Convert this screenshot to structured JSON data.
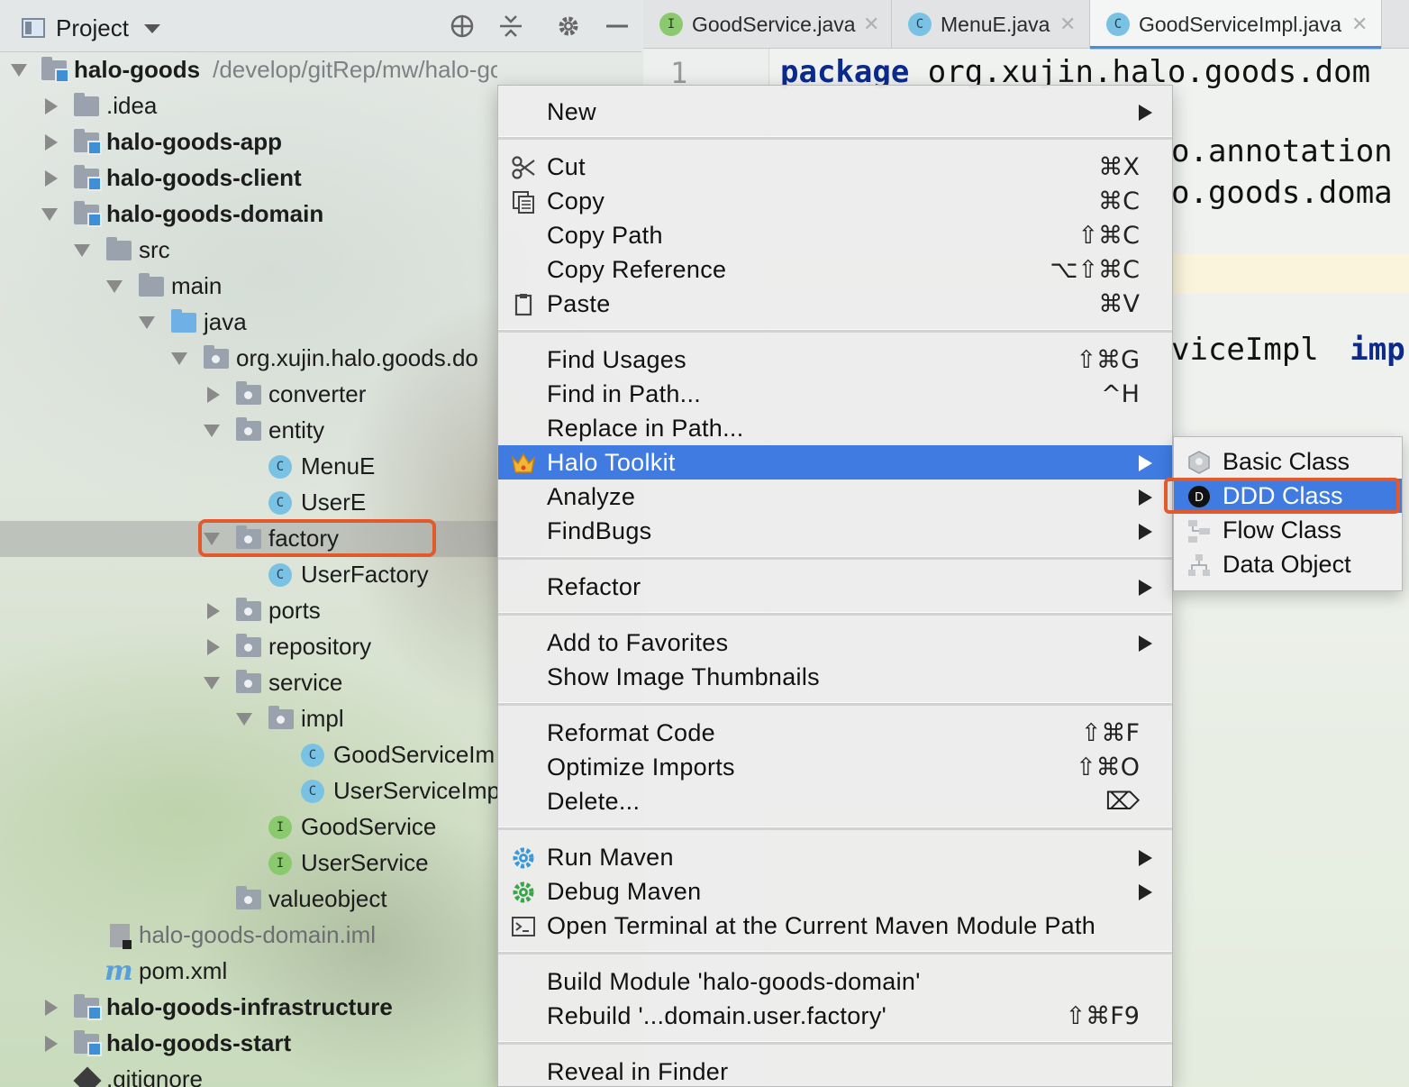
{
  "project_panel": {
    "title": "Project",
    "tree": [
      {
        "label": "halo-goods",
        "path": "/develop/gitRep/mw/halo-goods"
      },
      {
        "label": ".idea"
      },
      {
        "label": "halo-goods-app"
      },
      {
        "label": "halo-goods-client"
      },
      {
        "label": "halo-goods-domain"
      },
      {
        "label": "src"
      },
      {
        "label": "main"
      },
      {
        "label": "java"
      },
      {
        "label": "org.xujin.halo.goods.do"
      },
      {
        "label": "converter"
      },
      {
        "label": "entity"
      },
      {
        "label": "MenuE",
        "badge": "C"
      },
      {
        "label": "UserE",
        "badge": "C"
      },
      {
        "label": "factory"
      },
      {
        "label": "UserFactory",
        "badge": "C"
      },
      {
        "label": "ports"
      },
      {
        "label": "repository"
      },
      {
        "label": "service"
      },
      {
        "label": "impl"
      },
      {
        "label": "GoodServiceIm",
        "badge": "C"
      },
      {
        "label": "UserServiceImp",
        "badge": "C"
      },
      {
        "label": "GoodService",
        "badge": "I"
      },
      {
        "label": "UserService",
        "badge": "I"
      },
      {
        "label": "valueobject"
      },
      {
        "label": "halo-goods-domain.iml"
      },
      {
        "label": "pom.xml",
        "icon": "m"
      },
      {
        "label": "halo-goods-infrastructure"
      },
      {
        "label": "halo-goods-start"
      },
      {
        "label": ".gitignore"
      }
    ]
  },
  "editor": {
    "tabs": [
      {
        "label": "GoodService.java",
        "badge": "I"
      },
      {
        "label": "MenuE.java",
        "badge": "C"
      },
      {
        "label": "GoodServiceImpl.java",
        "badge": "C"
      }
    ],
    "line_number": "1",
    "code": {
      "line1_kw": "package",
      "line1_rest": "org.xujin.halo.goods.dom",
      "line2": "o.annotation",
      "line3": "o.goods.doma",
      "line4_text": "viceImpl",
      "line4_kw": "imp"
    }
  },
  "context_menu": {
    "items": [
      {
        "label": "New",
        "submenu": true
      },
      {
        "label": "Cut",
        "shortcut": "⌘X",
        "icon": "scissors-icon"
      },
      {
        "label": "Copy",
        "shortcut": "⌘C",
        "icon": "copy-icon"
      },
      {
        "label": "Copy Path",
        "shortcut": "⇧⌘C"
      },
      {
        "label": "Copy Reference",
        "shortcut": "⌥⇧⌘C"
      },
      {
        "label": "Paste",
        "shortcut": "⌘V",
        "icon": "clipboard-icon"
      },
      {
        "label": "Find Usages",
        "shortcut": "⇧⌘G"
      },
      {
        "label": "Find in Path...",
        "shortcut": "^H"
      },
      {
        "label": "Replace in Path..."
      },
      {
        "label": "Halo Toolkit",
        "submenu": true,
        "icon": "crown-icon",
        "active": true
      },
      {
        "label": "Analyze",
        "submenu": true
      },
      {
        "label": "FindBugs",
        "submenu": true
      },
      {
        "label": "Refactor",
        "submenu": true
      },
      {
        "label": "Add to Favorites",
        "submenu": true
      },
      {
        "label": "Show Image Thumbnails"
      },
      {
        "label": "Reformat Code",
        "shortcut": "⇧⌘F"
      },
      {
        "label": "Optimize Imports",
        "shortcut": "⇧⌘O"
      },
      {
        "label": "Delete...",
        "shortcut": "⌦"
      },
      {
        "label": "Run Maven",
        "submenu": true,
        "icon": "maven-run-icon"
      },
      {
        "label": "Debug Maven",
        "submenu": true,
        "icon": "maven-debug-icon"
      },
      {
        "label": "Open Terminal at the Current Maven Module Path",
        "icon": "terminal-icon"
      },
      {
        "label": "Build Module 'halo-goods-domain'"
      },
      {
        "label": "Rebuild '...domain.user.factory'",
        "shortcut": "⇧⌘F9"
      },
      {
        "label": "Reveal in Finder"
      }
    ]
  },
  "submenu": {
    "items": [
      {
        "label": "Basic Class",
        "icon": "basic-class-icon"
      },
      {
        "label": "DDD Class",
        "icon": "ddd-icon",
        "active": true
      },
      {
        "label": "Flow Class",
        "icon": "flow-icon"
      },
      {
        "label": "Data Object",
        "icon": "data-object-icon"
      }
    ]
  },
  "colors": {
    "accent": "#3f7be0",
    "highlight_box": "#e25a2b"
  }
}
